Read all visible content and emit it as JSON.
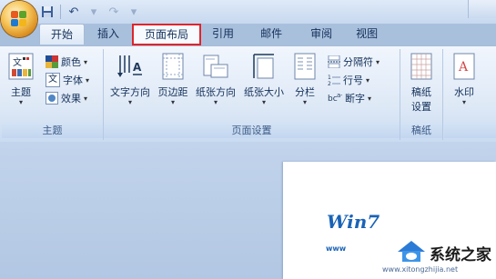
{
  "qat": {
    "save_icon": "save-icon",
    "undo_icon": "undo-icon",
    "redo_icon": "redo-icon"
  },
  "tabs": [
    {
      "label": "开始"
    },
    {
      "label": "插入"
    },
    {
      "label": "页面布局"
    },
    {
      "label": "引用"
    },
    {
      "label": "邮件"
    },
    {
      "label": "审阅"
    },
    {
      "label": "视图"
    }
  ],
  "ribbon": {
    "theme_group": {
      "label": "主题",
      "theme_button": "主题",
      "colors": "颜色",
      "fonts": "字体",
      "effects": "效果"
    },
    "page_setup_group": {
      "label": "页面设置",
      "text_direction": "文字方向",
      "margins": "页边距",
      "orientation": "纸张方向",
      "size": "纸张大小",
      "columns": "分栏",
      "breaks": "分隔符",
      "line_numbers": "行号",
      "hyphenation": "断字"
    },
    "draft_group": {
      "label": "稿纸",
      "draft_settings_line1": "稿纸",
      "draft_settings_line2": "设置"
    },
    "background_group": {
      "watermark": "水印"
    }
  },
  "watermark": {
    "brand": "Win7",
    "site_name": "系统之家",
    "url": "www.xitongzhijia.net",
    "www": "www"
  },
  "colors": {
    "highlight_border": "#e0242b",
    "ribbon_bg": "#dde8f6",
    "doc_bg": "#b2c7e3"
  }
}
